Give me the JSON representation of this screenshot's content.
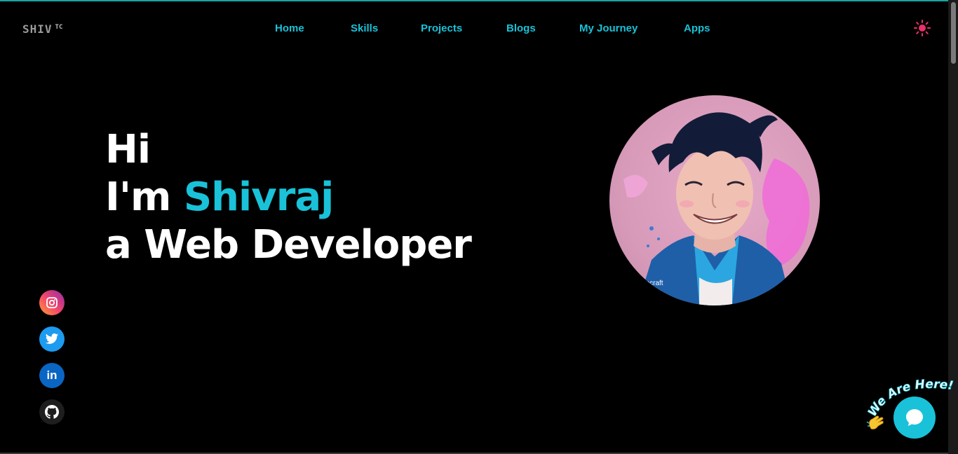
{
  "logo": {
    "text": "SHIV",
    "sup": "TC"
  },
  "nav": {
    "items": [
      {
        "label": "Home"
      },
      {
        "label": "Skills"
      },
      {
        "label": "Projects"
      },
      {
        "label": "Blogs"
      },
      {
        "label": "My Journey"
      },
      {
        "label": "Apps"
      }
    ]
  },
  "theme_toggle": {
    "icon": "sun-icon",
    "color": "#e8306a"
  },
  "hero": {
    "line1": "Hi",
    "line2_prefix": "I'm ",
    "line2_name": "Shivraj",
    "line3": "a Web Developer"
  },
  "avatar": {
    "watermark": "encraft"
  },
  "socials": [
    {
      "icon": "instagram-icon"
    },
    {
      "icon": "twitter-icon"
    },
    {
      "icon": "linkedin-icon",
      "text": "in"
    },
    {
      "icon": "github-icon"
    }
  ],
  "chat": {
    "badge_text": "We Are Here!",
    "accent": "#19c2d8"
  },
  "colors": {
    "accent": "#19c2d8",
    "background": "#000000",
    "text": "#ffffff"
  }
}
